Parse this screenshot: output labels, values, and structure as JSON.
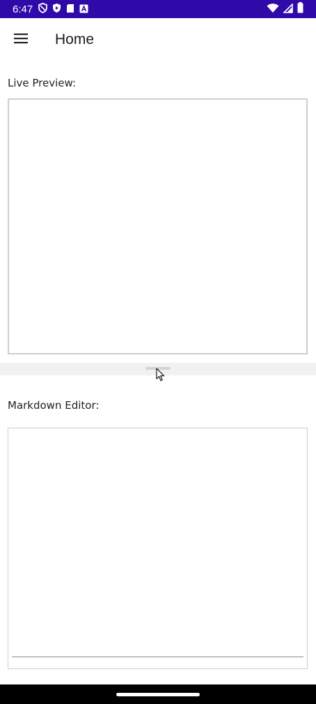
{
  "status_bar": {
    "time": "6:47",
    "background_color": "#2f0aa8",
    "left_icons": [
      "shield-icon",
      "play-protect-icon",
      "sd-card-icon",
      "accessibility-a-icon"
    ],
    "right_icons": [
      "wifi-icon",
      "cellular-signal-icon",
      "battery-icon"
    ]
  },
  "app_bar": {
    "menu_icon": "hamburger-menu-icon",
    "title": "Home"
  },
  "live_preview": {
    "label": "Live Preview:"
  },
  "markdown_editor": {
    "label": "Markdown Editor:",
    "value": ""
  },
  "navigation_bar": {
    "handle": "gesture-handle"
  }
}
